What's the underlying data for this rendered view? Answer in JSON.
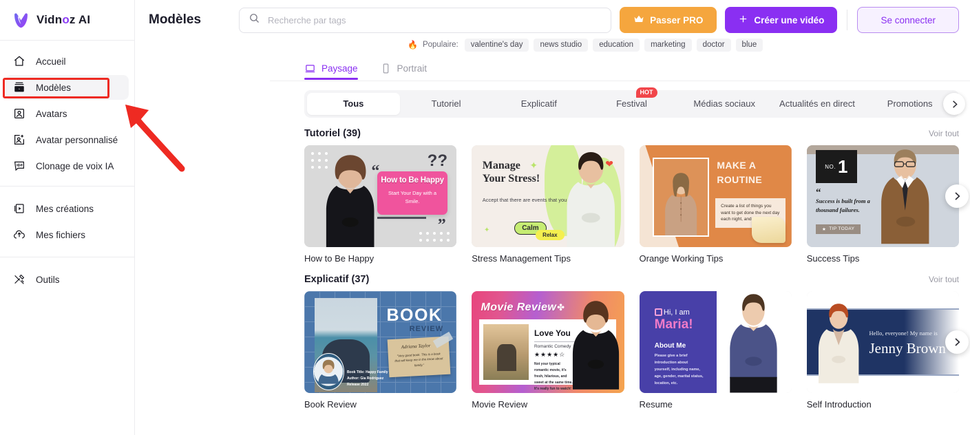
{
  "brand": {
    "name_before": "Vidn",
    "name_o": "o",
    "name_after": "z AI"
  },
  "sidebar": {
    "group1": [
      {
        "label": "Accueil",
        "icon": "home-icon"
      },
      {
        "label": "Modèles",
        "icon": "templates-icon",
        "active": true
      },
      {
        "label": "Avatars",
        "icon": "avatar-icon"
      },
      {
        "label": "Avatar personnalisé",
        "icon": "custom-avatar-icon"
      },
      {
        "label": "Clonage de voix IA",
        "icon": "voice-clone-icon"
      }
    ],
    "group2": [
      {
        "label": "Mes créations",
        "icon": "my-creations-icon"
      },
      {
        "label": "Mes fichiers",
        "icon": "my-files-icon"
      }
    ],
    "group3": [
      {
        "label": "Outils",
        "icon": "tools-icon"
      }
    ]
  },
  "header": {
    "title": "Modèles",
    "search_placeholder": "Recherche par tags",
    "search_value": "",
    "pro_button": "Passer PRO",
    "create_button": "Créer une vidéo",
    "login_button": "Se connecter"
  },
  "popular": {
    "label": "Populaire:",
    "tags": [
      "valentine's day",
      "news studio",
      "education",
      "marketing",
      "doctor",
      "blue"
    ]
  },
  "orientation_tabs": [
    {
      "label": "Paysage",
      "icon": "laptop-icon",
      "active": true
    },
    {
      "label": "Portrait",
      "icon": "phone-icon",
      "active": false
    }
  ],
  "category_tabs": [
    {
      "label": "Tous",
      "active": true
    },
    {
      "label": "Tutoriel",
      "active": false
    },
    {
      "label": "Explicatif",
      "active": false
    },
    {
      "label": "Festival",
      "active": false,
      "badge": "HOT"
    },
    {
      "label": "Médias sociaux",
      "active": false
    },
    {
      "label": "Actualités en direct",
      "active": false
    },
    {
      "label": "Promotions",
      "active": false
    }
  ],
  "sections": [
    {
      "title": "Tutoriel (39)",
      "see_all": "Voir tout",
      "cards": [
        {
          "title": "How to Be Happy",
          "art": {
            "heading": "How to Be Happy",
            "sub": "Start Your Day with a Smile."
          }
        },
        {
          "title": "Stress Management Tips",
          "art": {
            "heading_line1": "Manage",
            "heading_line2": "Your Stress!",
            "sub": "Accept that there are events that you cannot control.",
            "pill1": "Calm",
            "pill2": "Relax"
          }
        },
        {
          "title": "Orange Working Tips",
          "art": {
            "heading": "MAKE A ROUTINE",
            "note": "Create a list of things you want to get done the next day each night, and stick to it."
          }
        },
        {
          "title": "Success Tips",
          "art": {
            "no_label": "NO.",
            "no_number": "1",
            "quote": "Success is built from a thousand failures.",
            "tip": "TIP TODAY"
          }
        }
      ]
    },
    {
      "title": "Explicatif (37)",
      "see_all": "Voir tout",
      "cards": [
        {
          "title": "Book Review",
          "art": {
            "heading": "BOOK",
            "sub": "REVIEW",
            "signature": "Adriana Taylor",
            "note": "\"Very good book. This is a book that will keep me in the know about family.\"",
            "meta1": "Book Title: Happy Family",
            "meta2": "Author: Gia Rodriguez",
            "meta3": "Release 2022"
          }
        },
        {
          "title": "Movie Review",
          "art": {
            "heading": "Movie Review",
            "movie_title": "Love You",
            "genre": "Romantic Comedy",
            "stars": "★★★★☆",
            "desc": "Not your typical romantic movie, it's fresh, hilarious, and sweet at the same time. It's really fun to watch!"
          }
        },
        {
          "title": "Resume",
          "art": {
            "hi": "Hi, I am",
            "name": "Maria!",
            "about_heading": "About Me",
            "about_body": "Please give a brief introduction about yourself, including name, age, gender, marital status, location, etc."
          }
        },
        {
          "title": "Self Introduction",
          "art": {
            "hello": "Hello, everyone! My name is",
            "name": "Jenny Brown"
          }
        }
      ]
    }
  ],
  "colors": {
    "accent": "#8a2ff2",
    "pro": "#f5a63e",
    "hot": "#f1454a",
    "highlight": "#ee2a22"
  }
}
